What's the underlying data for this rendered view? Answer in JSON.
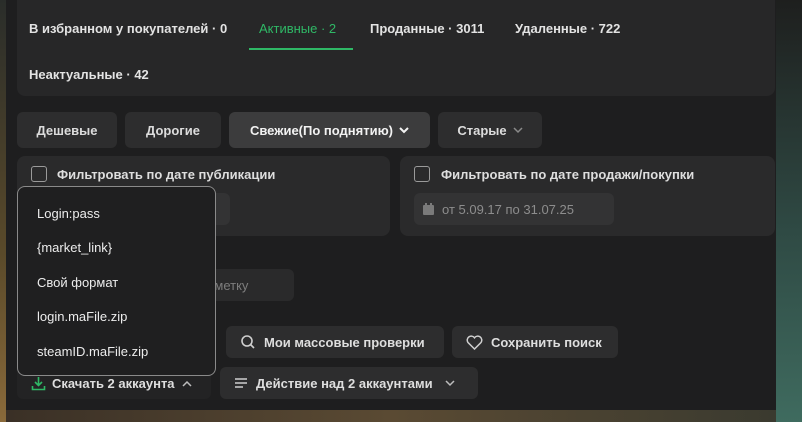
{
  "tabs": [
    {
      "label": "В избранном у покупателей · 0"
    },
    {
      "label": "Активные · 2",
      "active": true
    },
    {
      "label": "Проданные · 3011"
    },
    {
      "label": "Удаленные · 722"
    },
    {
      "label": "Неактуальные · 42"
    }
  ],
  "sort": {
    "cheap": "Дешевые",
    "expensive": "Дорогие",
    "fresh": "Свежие(По поднятию)",
    "old": "Старые"
  },
  "filters": {
    "publish_date": {
      "label": "Фильтровать по дате публикации"
    },
    "sale_date": {
      "label": "Фильтровать по дате продажи/покупки",
      "range": "от 5.09.17 по 31.07.25"
    }
  },
  "tag_input": {
    "placeholder_visible": "ь метку"
  },
  "actions": {
    "mass_checks": "Мои массовые проверки",
    "save_search": "Сохранить поиск",
    "download": "Скачать 2 аккаунта",
    "bulk_action": "Действие над 2 аккаунтами"
  },
  "download_menu": {
    "items": [
      "Login:pass",
      "{market_link}",
      "Свой формат",
      "login.maFile.zip",
      "steamID.maFile.zip"
    ]
  },
  "colors": {
    "accent": "#2fb866",
    "background": "#1e1e1f",
    "card": "#2a2a2b"
  }
}
